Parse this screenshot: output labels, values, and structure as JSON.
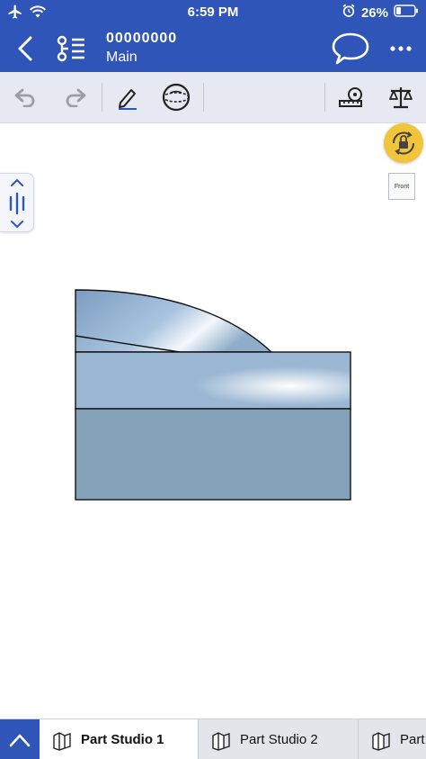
{
  "status": {
    "time": "6:59 PM",
    "battery": "26%"
  },
  "header": {
    "doc_name": "00000000",
    "branch": "Main"
  },
  "view": {
    "orientation_label": "Front"
  },
  "colors": {
    "brand": "#2f55b8",
    "part_face": "#8aa6bd",
    "lock": "#f0c53a"
  },
  "toolbar": {
    "icons": [
      "undo-icon",
      "redo-icon",
      "sketch-pencil-icon",
      "sphere-view-icon",
      "measure-tape-icon",
      "mass-properties-scale-icon"
    ]
  },
  "tabs": [
    {
      "label": "Part Studio 1",
      "active": true
    },
    {
      "label": "Part Studio 2",
      "active": false
    },
    {
      "label": "Part",
      "active": false
    }
  ]
}
